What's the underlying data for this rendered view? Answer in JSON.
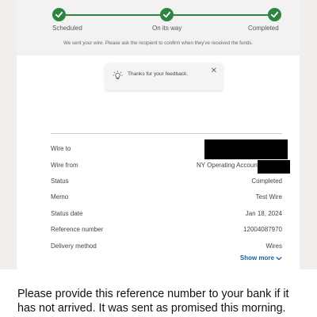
{
  "progress": {
    "steps": [
      {
        "label": "Scheduled",
        "done": true
      },
      {
        "label": "On its way",
        "done": true
      },
      {
        "label": "Completed",
        "done": true
      }
    ],
    "message": "We sent your wire. Please ask the recipient to confirm when they've received the funds."
  },
  "feedback": {
    "text": "Thanks for your feedback.",
    "close": "✕"
  },
  "details": {
    "rows": [
      {
        "label": "Wire to",
        "value": ""
      },
      {
        "label": "Wire from",
        "value": "NY Operating Account"
      },
      {
        "label": "Status",
        "value": "Completed"
      },
      {
        "label": "Memo",
        "value": "Test Wire"
      },
      {
        "label": "Status date",
        "value": "Jan 18, 2024"
      },
      {
        "label": "Reference number",
        "value": "12004087970"
      },
      {
        "label": "Delivery method",
        "value": "Wires"
      }
    ],
    "show_more": "Show more"
  },
  "caption": "Please provide this reference number to your bank if it has not arrived. It was sent as promised this morning.",
  "colors": {
    "success": "#2e8540",
    "link": "#1d5d9b"
  }
}
